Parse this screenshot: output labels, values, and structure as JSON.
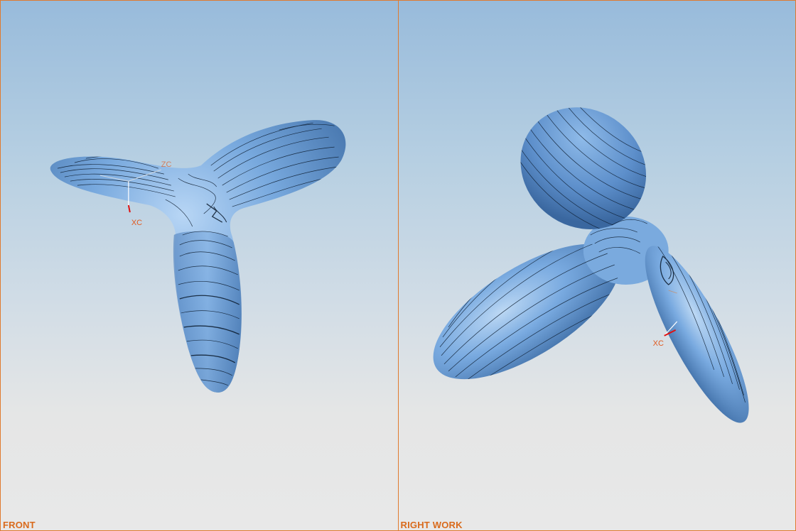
{
  "viewports": {
    "front": {
      "label": "FRONT"
    },
    "right": {
      "label": "RIGHT WORK"
    }
  },
  "triad": {
    "xc": "XC",
    "zc": "ZC"
  },
  "colors": {
    "border": "#e07a2e",
    "model": "#6f9fd6",
    "axis": "#e05a20",
    "label": "#d96a1c"
  }
}
